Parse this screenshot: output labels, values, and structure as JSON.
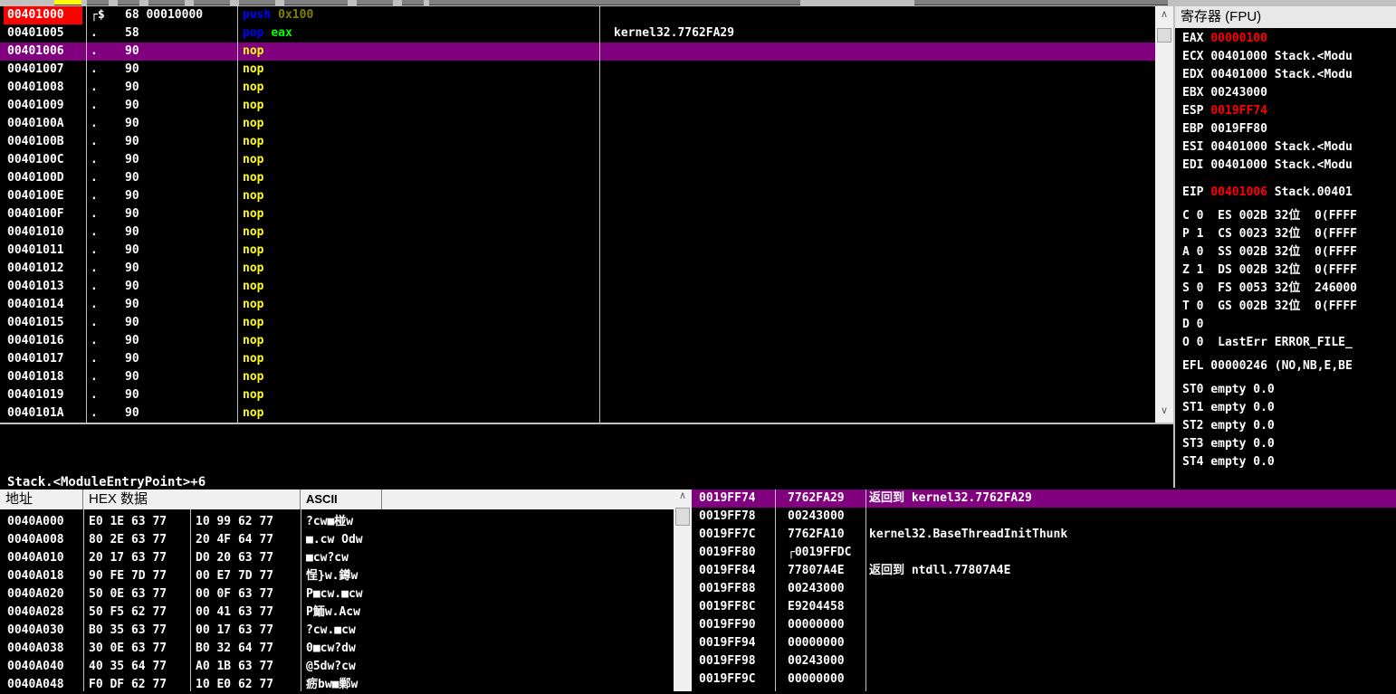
{
  "disasm": {
    "rows": [
      {
        "addr": "00401000",
        "mark": "┌$",
        "hex": "68 00010000",
        "mnemonic": "push",
        "operand": "0x100",
        "comment": "",
        "eip": true
      },
      {
        "addr": "00401005",
        "mark": ".",
        "hex": "58",
        "mnemonic": "pop",
        "operand": "eax",
        "comment": "kernel32.7762FA29"
      },
      {
        "addr": "00401006",
        "mark": ".",
        "hex": "90",
        "mnemonic": "nop",
        "operand": "",
        "comment": "",
        "selected": true
      },
      {
        "addr": "00401007",
        "mark": ".",
        "hex": "90",
        "mnemonic": "nop",
        "operand": "",
        "comment": ""
      },
      {
        "addr": "00401008",
        "mark": ".",
        "hex": "90",
        "mnemonic": "nop",
        "operand": "",
        "comment": ""
      },
      {
        "addr": "00401009",
        "mark": ".",
        "hex": "90",
        "mnemonic": "nop",
        "operand": "",
        "comment": ""
      },
      {
        "addr": "0040100A",
        "mark": ".",
        "hex": "90",
        "mnemonic": "nop",
        "operand": "",
        "comment": ""
      },
      {
        "addr": "0040100B",
        "mark": ".",
        "hex": "90",
        "mnemonic": "nop",
        "operand": "",
        "comment": ""
      },
      {
        "addr": "0040100C",
        "mark": ".",
        "hex": "90",
        "mnemonic": "nop",
        "operand": "",
        "comment": ""
      },
      {
        "addr": "0040100D",
        "mark": ".",
        "hex": "90",
        "mnemonic": "nop",
        "operand": "",
        "comment": ""
      },
      {
        "addr": "0040100E",
        "mark": ".",
        "hex": "90",
        "mnemonic": "nop",
        "operand": "",
        "comment": ""
      },
      {
        "addr": "0040100F",
        "mark": ".",
        "hex": "90",
        "mnemonic": "nop",
        "operand": "",
        "comment": ""
      },
      {
        "addr": "00401010",
        "mark": ".",
        "hex": "90",
        "mnemonic": "nop",
        "operand": "",
        "comment": ""
      },
      {
        "addr": "00401011",
        "mark": ".",
        "hex": "90",
        "mnemonic": "nop",
        "operand": "",
        "comment": ""
      },
      {
        "addr": "00401012",
        "mark": ".",
        "hex": "90",
        "mnemonic": "nop",
        "operand": "",
        "comment": ""
      },
      {
        "addr": "00401013",
        "mark": ".",
        "hex": "90",
        "mnemonic": "nop",
        "operand": "",
        "comment": ""
      },
      {
        "addr": "00401014",
        "mark": ".",
        "hex": "90",
        "mnemonic": "nop",
        "operand": "",
        "comment": ""
      },
      {
        "addr": "00401015",
        "mark": ".",
        "hex": "90",
        "mnemonic": "nop",
        "operand": "",
        "comment": ""
      },
      {
        "addr": "00401016",
        "mark": ".",
        "hex": "90",
        "mnemonic": "nop",
        "operand": "",
        "comment": ""
      },
      {
        "addr": "00401017",
        "mark": ".",
        "hex": "90",
        "mnemonic": "nop",
        "operand": "",
        "comment": ""
      },
      {
        "addr": "00401018",
        "mark": ".",
        "hex": "90",
        "mnemonic": "nop",
        "operand": "",
        "comment": ""
      },
      {
        "addr": "00401019",
        "mark": ".",
        "hex": "90",
        "mnemonic": "nop",
        "operand": "",
        "comment": ""
      },
      {
        "addr": "0040101A",
        "mark": ".",
        "hex": "90",
        "mnemonic": "nop",
        "operand": "",
        "comment": ""
      }
    ]
  },
  "info": {
    "text": "Stack.<ModuleEntryPoint>+6"
  },
  "registers": {
    "title": "寄存器 (FPU)",
    "lines": [
      {
        "name": "EAX",
        "value": "00000100",
        "rest": "",
        "changed": true
      },
      {
        "name": "ECX",
        "value": "00401000",
        "rest": "Stack.<Modu",
        "changed": false
      },
      {
        "name": "EDX",
        "value": "00401000",
        "rest": "Stack.<Modu",
        "changed": false
      },
      {
        "name": "EBX",
        "value": "00243000",
        "rest": "",
        "changed": false
      },
      {
        "name": "ESP",
        "value": "0019FF74",
        "rest": "",
        "changed": true
      },
      {
        "name": "EBP",
        "value": "0019FF80",
        "rest": "",
        "changed": false
      },
      {
        "name": "ESI",
        "value": "00401000",
        "rest": "Stack.<Modu",
        "changed": false
      },
      {
        "name": "EDI",
        "value": "00401000",
        "rest": "Stack.<Modu",
        "changed": false
      },
      {
        "name": "EIP",
        "value": "00401006",
        "rest": "Stack.00401",
        "changed": true
      }
    ],
    "flags": [
      "C 0  ES 002B 32位  0(FFFF",
      "P 1  CS 0023 32位  0(FFFF",
      "A 0  SS 002B 32位  0(FFFF",
      "Z 1  DS 002B 32位  0(FFFF",
      "S 0  FS 0053 32位  246000",
      "T 0  GS 002B 32位  0(FFFF",
      "D 0",
      "O 0  LastErr ERROR_FILE_"
    ],
    "efl": "EFL 00000246 (NO,NB,E,BE",
    "fpu": [
      "ST0 empty 0.0",
      "ST1 empty 0.0",
      "ST2 empty 0.0",
      "ST3 empty 0.0",
      "ST4 empty 0.0"
    ]
  },
  "dump": {
    "headers": {
      "addr": "地址",
      "hex": "HEX 数据",
      "ascii": "ASCII"
    },
    "rows": [
      {
        "addr": "0040A000",
        "hex1": "E0 1E 63 77",
        "hex2": "10 99 62 77",
        "ascii": "?cw■椪w"
      },
      {
        "addr": "0040A008",
        "hex1": "80 2E 63 77",
        "hex2": "20 4F 64 77",
        "ascii": "■.cw Odw"
      },
      {
        "addr": "0040A010",
        "hex1": "20 17 63 77",
        "hex2": "D0 20 63 77",
        "ascii": " ■cw?cw"
      },
      {
        "addr": "0040A018",
        "hex1": "90 FE 7D 77",
        "hex2": "00 E7 7D 77",
        "ascii": "悜}w.鐏w"
      },
      {
        "addr": "0040A020",
        "hex1": "50 0E 63 77",
        "hex2": "00 0F 63 77",
        "ascii": "P■cw.■cw"
      },
      {
        "addr": "0040A028",
        "hex1": "50 F5 62 77",
        "hex2": "00 41 63 77",
        "ascii": "P鮞w.Acw"
      },
      {
        "addr": "0040A030",
        "hex1": "B0 35 63 77",
        "hex2": "00 17 63 77",
        "ascii": "?cw.■cw"
      },
      {
        "addr": "0040A038",
        "hex1": "30 0E 63 77",
        "hex2": "B0 32 64 77",
        "ascii": "0■cw?dw"
      },
      {
        "addr": "0040A040",
        "hex1": "40 35 64 77",
        "hex2": "A0 1B 63 77",
        "ascii": "@5dw?cw"
      },
      {
        "addr": "0040A048",
        "hex1": "F0 DF 62 77",
        "hex2": "10 E0 62 77",
        "ascii": "疬bw■鄛w"
      }
    ]
  },
  "stack": {
    "rows": [
      {
        "addr": "0019FF74",
        "value": "7762FA29",
        "comment": "返回到 kernel32.7762FA29",
        "selected": true
      },
      {
        "addr": "0019FF78",
        "value": "00243000",
        "comment": ""
      },
      {
        "addr": "0019FF7C",
        "value": "7762FA10",
        "comment": "kernel32.BaseThreadInitThunk"
      },
      {
        "addr": "0019FF80",
        "value": "┌0019FFDC",
        "comment": ""
      },
      {
        "addr": "0019FF84",
        "value": "77807A4E",
        "comment": "返回到 ntdll.77807A4E"
      },
      {
        "addr": "0019FF88",
        "value": "00243000",
        "comment": ""
      },
      {
        "addr": "0019FF8C",
        "value": "E9204458",
        "comment": ""
      },
      {
        "addr": "0019FF90",
        "value": "00000000",
        "comment": ""
      },
      {
        "addr": "0019FF94",
        "value": "00000000",
        "comment": ""
      },
      {
        "addr": "0019FF98",
        "value": "00243000",
        "comment": ""
      },
      {
        "addr": "0019FF9C",
        "value": "00000000",
        "comment": ""
      }
    ]
  },
  "colors": {
    "selected_row": "#800080",
    "eip_highlight": "#ff0000",
    "mnemonic": "#ffff00",
    "push_pop": "#0000ff",
    "operand_imm": "#808000",
    "operand_reg": "#00ff00",
    "changed_register": "#ff0000"
  }
}
